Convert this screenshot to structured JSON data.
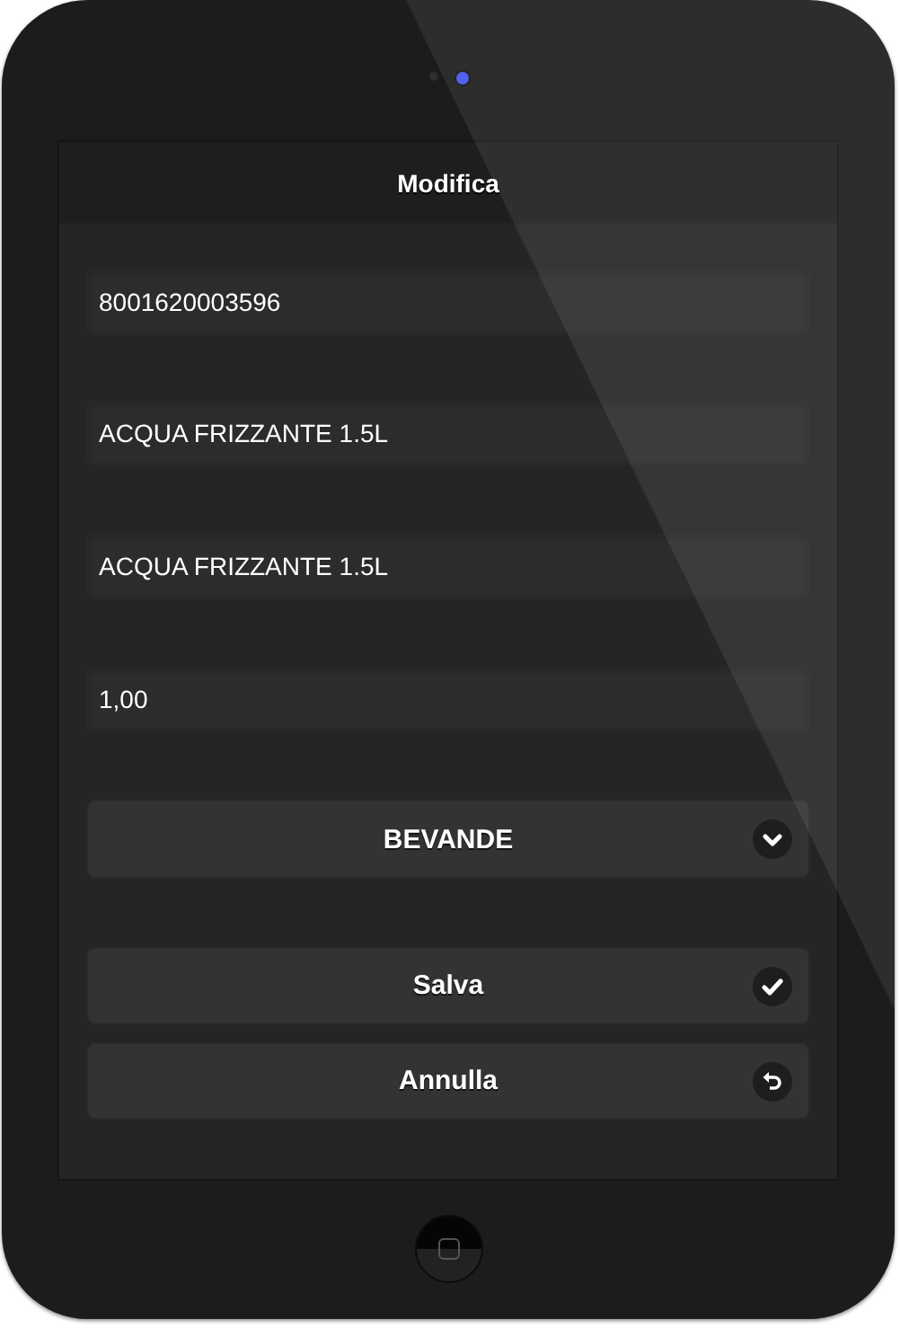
{
  "header": {
    "title": "Modifica"
  },
  "fields": [
    {
      "value": "8001620003596"
    },
    {
      "value": "ACQUA FRIZZANTE 1.5L"
    },
    {
      "value": "ACQUA FRIZZANTE 1.5L"
    },
    {
      "value": "1,00"
    }
  ],
  "select": {
    "value": "BEVANDE"
  },
  "buttons": [
    {
      "label": "Salva",
      "kind": "save"
    },
    {
      "label": "Annulla",
      "kind": "cancel"
    }
  ]
}
